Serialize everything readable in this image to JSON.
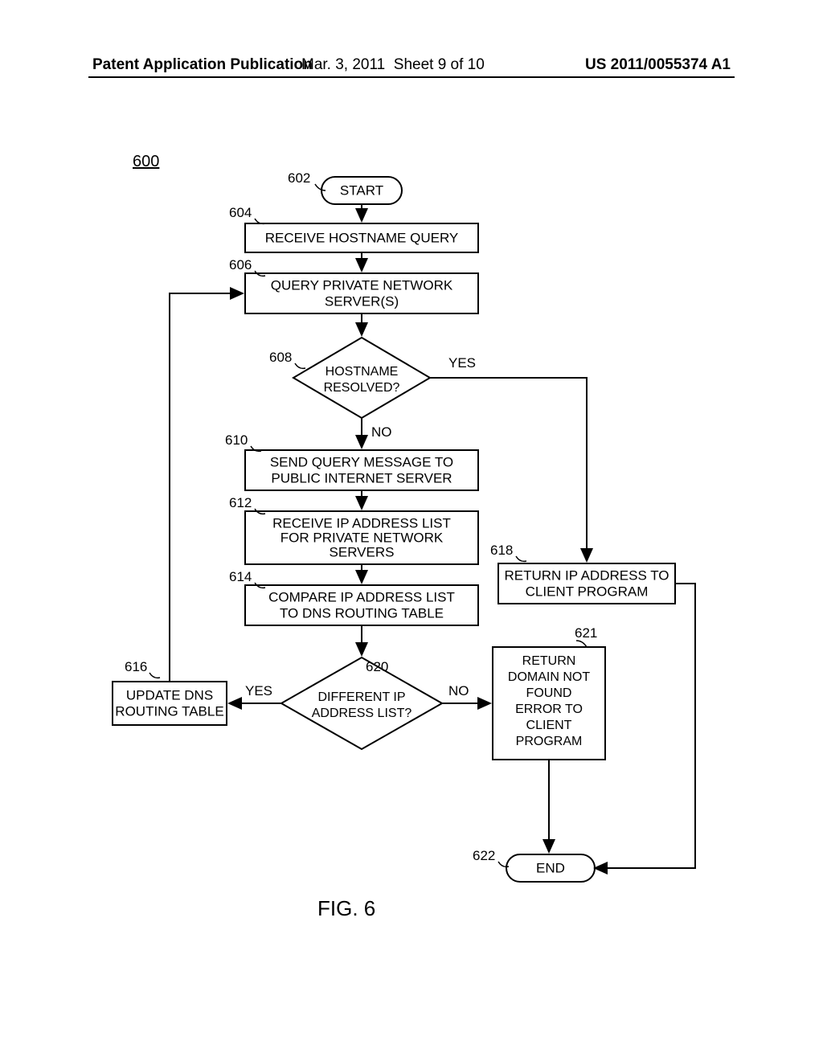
{
  "header": {
    "left": "Patent Application Publication",
    "date": "Mar. 3, 2011",
    "sheet": "Sheet 9 of 10",
    "pubno": "US 2011/0055374 A1"
  },
  "figure": {
    "ref": "600",
    "caption": "FIG. 6"
  },
  "labels": {
    "n602": "602",
    "n604": "604",
    "n606": "606",
    "n608": "608",
    "n610": "610",
    "n612": "612",
    "n614": "614",
    "n616": "616",
    "n618": "618",
    "n620": "620",
    "n621": "621",
    "n622": "622"
  },
  "nodes": {
    "start": "START",
    "receive_query": "RECEIVE HOSTNAME QUERY",
    "query_private_l1": "QUERY PRIVATE NETWORK",
    "query_private_l2": "SERVER(S)",
    "resolved_l1": "HOSTNAME",
    "resolved_l2": "RESOLVED?",
    "send_public_l1": "SEND QUERY MESSAGE TO",
    "send_public_l2": "PUBLIC INTERNET SERVER",
    "receive_list_l1": "RECEIVE IP ADDRESS LIST",
    "receive_list_l2": "FOR PRIVATE NETWORK",
    "receive_list_l3": "SERVERS",
    "compare_l1": "COMPARE IP ADDRESS LIST",
    "compare_l2": "TO DNS ROUTING TABLE",
    "diff_l1": "DIFFERENT IP",
    "diff_l2": "ADDRESS LIST?",
    "update_l1": "UPDATE DNS",
    "update_l2": "ROUTING TABLE",
    "return_ip_l1": "RETURN IP ADDRESS TO",
    "return_ip_l2": "CLIENT PROGRAM",
    "notfound_l1": "RETURN",
    "notfound_l2": "DOMAIN NOT",
    "notfound_l3": "FOUND",
    "notfound_l4": "ERROR TO",
    "notfound_l5": "CLIENT",
    "notfound_l6": "PROGRAM",
    "end": "END"
  },
  "edges": {
    "yes": "YES",
    "no": "NO"
  }
}
